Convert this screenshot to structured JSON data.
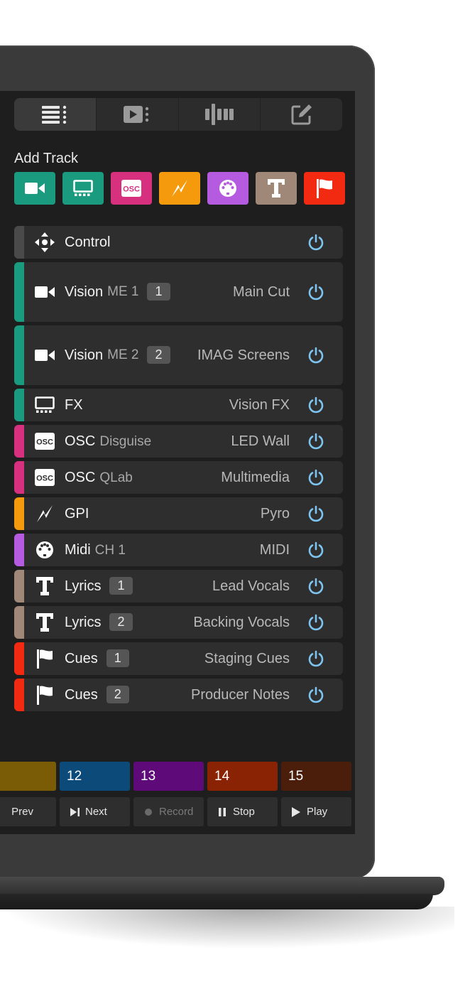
{
  "add_track": {
    "label": "Add Track",
    "buttons": [
      {
        "icon": "camera-icon",
        "color": "#1a9a7e"
      },
      {
        "icon": "monitor-icon",
        "color": "#1a9a7e"
      },
      {
        "icon": "osc-icon",
        "color": "#d6307f",
        "text": "OSC"
      },
      {
        "icon": "lightning-icon",
        "color": "#f59a0c"
      },
      {
        "icon": "midi-icon",
        "color": "#b55be0"
      },
      {
        "icon": "text-icon",
        "color": "#a08878"
      },
      {
        "icon": "flag-icon",
        "color": "#f22a12"
      }
    ]
  },
  "tracks": [
    {
      "name": "Control",
      "sub": "",
      "badge": "",
      "right": "",
      "color": "#4a4a4a",
      "icon": "move-icon",
      "tall": false
    },
    {
      "name": "Vision",
      "sub": "ME 1",
      "badge": "1",
      "right": "Main Cut",
      "color": "#1a9a7e",
      "icon": "camera-icon",
      "tall": true
    },
    {
      "name": "Vision",
      "sub": "ME 2",
      "badge": "2",
      "right": "IMAG Screens",
      "color": "#1a9a7e",
      "icon": "camera-icon",
      "tall": true
    },
    {
      "name": "FX",
      "sub": "",
      "badge": "",
      "right": "Vision FX",
      "color": "#1a9a7e",
      "icon": "monitor-icon",
      "tall": false
    },
    {
      "name": "OSC",
      "sub": "Disguise",
      "badge": "",
      "right": "LED Wall",
      "color": "#d6307f",
      "icon": "osc-icon",
      "tall": false
    },
    {
      "name": "OSC",
      "sub": "QLab",
      "badge": "",
      "right": "Multimedia",
      "color": "#d6307f",
      "icon": "osc-icon",
      "tall": false
    },
    {
      "name": "GPI",
      "sub": "",
      "badge": "",
      "right": "Pyro",
      "color": "#f59a0c",
      "icon": "lightning-icon",
      "tall": false
    },
    {
      "name": "Midi",
      "sub": "CH 1",
      "badge": "",
      "right": "MIDI",
      "color": "#b55be0",
      "icon": "midi-icon",
      "tall": false
    },
    {
      "name": "Lyrics",
      "sub": "",
      "badge": "1",
      "right": "Lead Vocals",
      "color": "#a08878",
      "icon": "text-icon",
      "tall": false
    },
    {
      "name": "Lyrics",
      "sub": "",
      "badge": "2",
      "right": "Backing Vocals",
      "color": "#a08878",
      "icon": "text-icon",
      "tall": false
    },
    {
      "name": "Cues",
      "sub": "",
      "badge": "1",
      "right": "Staging Cues",
      "color": "#f22a12",
      "icon": "flag-icon",
      "tall": false
    },
    {
      "name": "Cues",
      "sub": "",
      "badge": "2",
      "right": "Producer Notes",
      "color": "#f22a12",
      "icon": "flag-icon",
      "tall": false
    }
  ],
  "cues": [
    {
      "label": "",
      "color": "#7a5c06"
    },
    {
      "label": "12",
      "color": "#0c4a7a"
    },
    {
      "label": "13",
      "color": "#5e0a78"
    },
    {
      "label": "14",
      "color": "#8a2204"
    },
    {
      "label": "15",
      "color": "#4a1e0a"
    }
  ],
  "transport": [
    {
      "label": "Prev",
      "icon": "prev-icon",
      "disabled": false
    },
    {
      "label": "Next",
      "icon": "next-icon",
      "disabled": false
    },
    {
      "label": "Record",
      "icon": "record-icon",
      "disabled": true
    },
    {
      "label": "Stop",
      "icon": "pause-icon",
      "disabled": false
    },
    {
      "label": "Play",
      "icon": "play-icon",
      "disabled": false
    }
  ],
  "colors": {
    "power": "#7ec4f0",
    "screen_bg": "#1e1e1e",
    "row_bg": "#2e2e2e"
  }
}
